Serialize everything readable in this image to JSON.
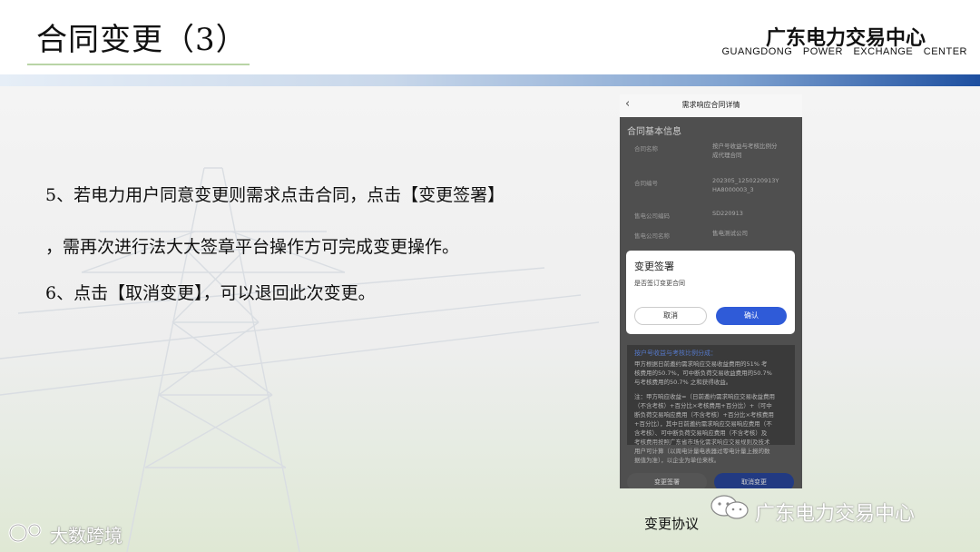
{
  "header": {
    "title": "合同变更（3）",
    "org_cn": "广东电力交易中心",
    "org_en": "GUANGDONG POWER EXCHANGE CENTER"
  },
  "body": {
    "line1": "5、若电力用户同意变更则需求点击合同，点击【变更签署】",
    "line2": "，需再次进行法大大签章平台操作方可完成变更操作。",
    "line3": "6、点击【取消变更】，可以退回此次变更。"
  },
  "phone": {
    "title": "需求响应合同详情",
    "section": "合同基本信息",
    "fields": [
      {
        "label": "合同名称",
        "value1": "按户号收益与考核比例分",
        "value2": "成代理合同"
      },
      {
        "label": "合同编号",
        "value1": "202305_1250220913Y",
        "value2": "HA8000003_3"
      },
      {
        "label": "售电公司编码",
        "value1": "SD220913",
        "value2": ""
      },
      {
        "label": "售电公司名称",
        "value1": "售电测试公司",
        "value2": ""
      }
    ],
    "sub_heading": "按户号收益与考核比例分成：",
    "para1": [
      "甲方根据日前邀约需求响应交易收益费用的51% 考",
      "核费用的50.7%，可中断负荷交易收益费用的50.7%",
      "与考核费用的50.7% 之和获得收益。"
    ],
    "para2": [
      "注：甲方响应收益=（日前邀约需求响应交易收益费用",
      "（不含考核）+百分比×考核费用+百分比）+（可中",
      "断负荷交易响应费用（不含考核）+百分比×考核费用",
      "+百分比），其中日前邀约需求响应交易响应费用（不",
      "含考核）、可中断负荷交易响应费用（不含考核）及",
      "考核费用按照广东省市场化需求响应交易规则及技术",
      "用户可计算（以周电计量电表器过零电计量上报的数",
      "据值为准），以企业为单位来核。"
    ],
    "btn_sign": "变更签署",
    "btn_cancel_change": "取消变更"
  },
  "dialog": {
    "title": "变更签署",
    "message": "是否签订变更合同",
    "cancel": "取消",
    "confirm": "确认"
  },
  "caption": "变更协议",
  "watermark_right": "广东电力交易中心",
  "watermark_left": "大数跨境",
  "colors": {
    "accent_blue": "#2f5bd8",
    "stripe_dark": "#1d4fa0",
    "title_underline": "#b9d4a6"
  }
}
